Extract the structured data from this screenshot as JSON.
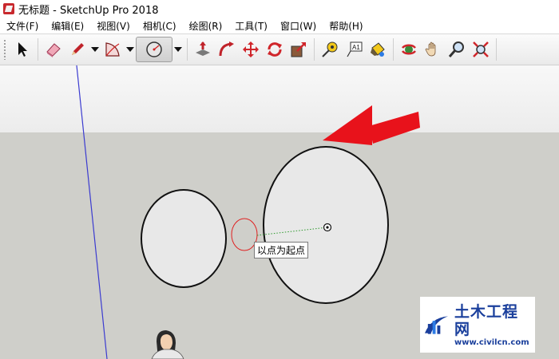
{
  "window": {
    "title": "无标题 - SketchUp Pro 2018"
  },
  "menu": [
    "文件(F)",
    "编辑(E)",
    "视图(V)",
    "相机(C)",
    "绘图(R)",
    "工具(T)",
    "窗口(W)",
    "帮助(H)"
  ],
  "toolbar": {
    "tools": [
      "select-icon",
      "eraser-icon",
      "pencil-icon",
      "arc-icon",
      "circle-icon",
      "push-pull-icon",
      "follow-me-icon",
      "move-icon",
      "rotate-icon",
      "scale-icon",
      "tape-measure-icon",
      "text-icon",
      "paint-bucket-icon",
      "orbit-icon",
      "pan-icon",
      "zoom-icon",
      "zoom-extents-icon"
    ],
    "active_tool": "circle-icon"
  },
  "canvas": {
    "tooltip": "以点为起点",
    "arrow_color": "#e8121b",
    "axis_color": "#3b3bd0"
  },
  "watermark": {
    "name": "土木工程网",
    "url": "www.civilcn.com"
  }
}
